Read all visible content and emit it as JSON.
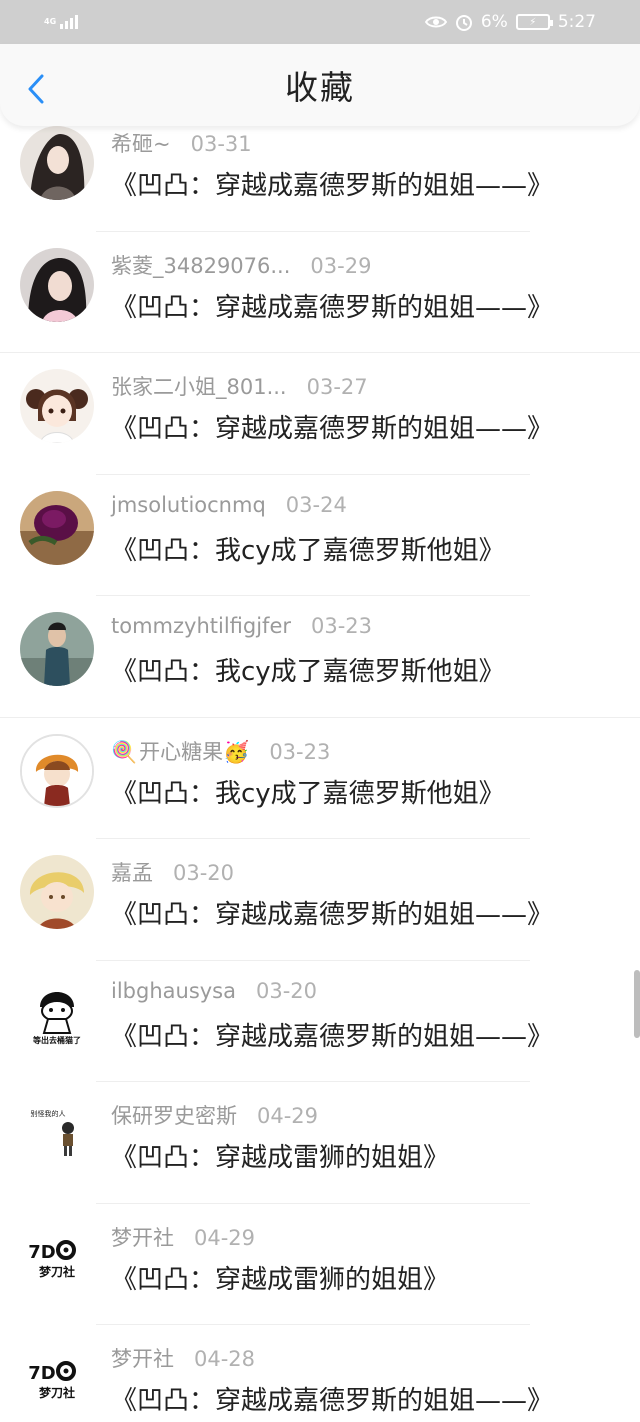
{
  "status_bar": {
    "network": "4G",
    "battery": "6%",
    "time": "5:27"
  },
  "header": {
    "title": "收藏"
  },
  "items": [
    {
      "name": "希砸~",
      "date": "03-31",
      "book": "《凹凸：穿越成嘉德罗斯的姐姐——》",
      "avatar": "avatar-anime-dark-hair"
    },
    {
      "name": "紫菱_34829076...",
      "date": "03-29",
      "book": "《凹凸：穿越成嘉德罗斯的姐姐——》",
      "avatar": "avatar-girl-photo"
    },
    {
      "name": "张家二小姐_801...",
      "date": "03-27",
      "book": "《凹凸：穿越成嘉德罗斯的姐姐——》",
      "avatar": "avatar-anime-pigtails"
    },
    {
      "name": "jmsolutiocnmq",
      "date": "03-24",
      "book": "《凹凸：我cy成了嘉德罗斯他姐》",
      "avatar": "avatar-purple-rose"
    },
    {
      "name": "tommzyhtilfigjfer",
      "date": "03-23",
      "book": "《凹凸：我cy成了嘉德罗斯他姐》",
      "avatar": "avatar-boy-photo"
    },
    {
      "name": "开心糖果",
      "date": "03-23",
      "book": "《凹凸：我cy成了嘉德罗斯他姐》",
      "avatar": "avatar-anime-orange"
    },
    {
      "name": "嘉孟",
      "date": "03-20",
      "book": "《凹凸：穿越成嘉德罗斯的姐姐——》",
      "avatar": "avatar-anime-blond"
    },
    {
      "name": "ilbghausysa",
      "date": "03-20",
      "book": "《凹凸：穿越成嘉德罗斯的姐姐——》",
      "avatar": "avatar-meme",
      "avatar_text": "等出去桶猫了"
    },
    {
      "name": "保研罗史密斯",
      "date": "04-29",
      "book": "《凹凸：穿越成雷狮的姐姐》",
      "avatar": "avatar-chibi-sticker",
      "avatar_text": "别怪我的人"
    },
    {
      "name": "梦开社",
      "date": "04-29",
      "book": "《凹凸：穿越成雷狮的姐姐》",
      "avatar": "avatar-logo",
      "avatar_text": "梦刀社"
    },
    {
      "name": "梦开社",
      "date": "04-28",
      "book": "《凹凸：穿越成嘉德罗斯的姐姐——》",
      "avatar": "avatar-logo",
      "avatar_text": "梦刀社"
    }
  ],
  "colors": {
    "title": "#222222",
    "name": "#9a9a9a",
    "back_arrow": "#2a8ff7"
  }
}
